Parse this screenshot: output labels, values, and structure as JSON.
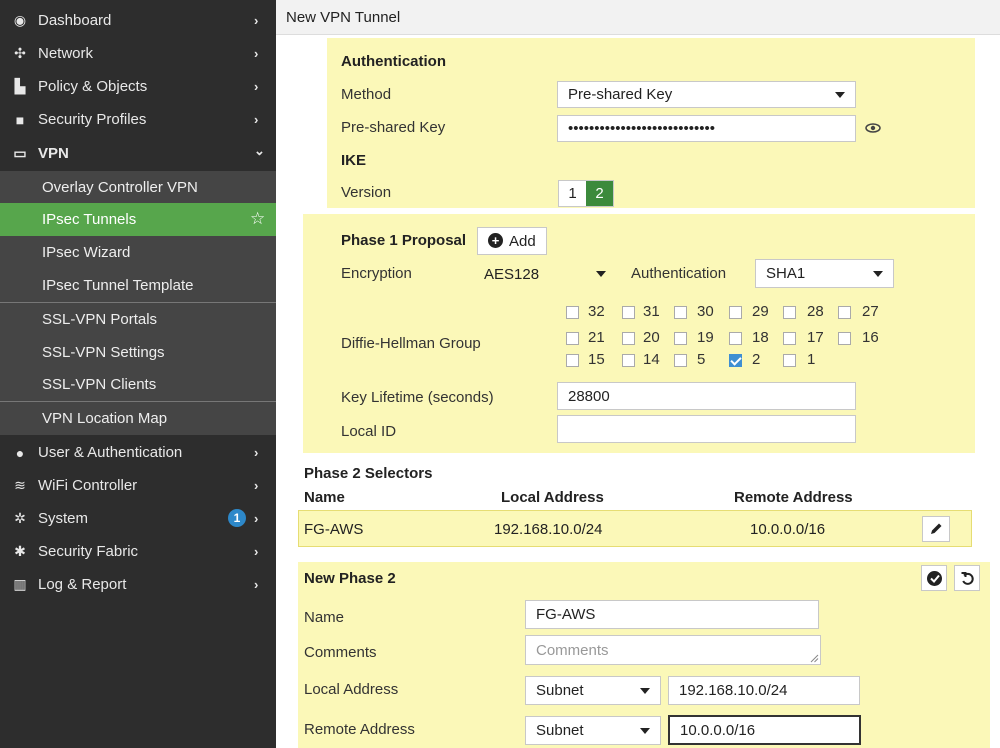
{
  "sidebar": {
    "items": [
      {
        "label": "Dashboard",
        "icon": "dashboard-icon",
        "glyph": "◉",
        "chev": "›"
      },
      {
        "label": "Network",
        "icon": "network-icon",
        "glyph": "✣",
        "chev": "›"
      },
      {
        "label": "Policy & Objects",
        "icon": "policy-icon",
        "glyph": "▙",
        "chev": "›"
      },
      {
        "label": "Security Profiles",
        "icon": "lock-icon",
        "glyph": "■",
        "chev": "›"
      },
      {
        "label": "VPN",
        "icon": "laptop-icon",
        "glyph": "▭",
        "chev": "⌄"
      }
    ],
    "vpn_sub": [
      {
        "label": "Overlay Controller VPN"
      },
      {
        "label": "IPsec Tunnels",
        "active": true
      },
      {
        "label": "IPsec Wizard"
      },
      {
        "label": "IPsec Tunnel Template"
      },
      {
        "label": "SSL-VPN Portals"
      },
      {
        "label": "SSL-VPN Settings"
      },
      {
        "label": "SSL-VPN Clients"
      },
      {
        "label": "VPN Location Map"
      }
    ],
    "star_glyph": "☆",
    "items2": [
      {
        "label": "User & Authentication",
        "icon": "user-icon",
        "glyph": "●",
        "chev": "›"
      },
      {
        "label": "WiFi Controller",
        "icon": "wifi-icon",
        "glyph": "≋",
        "chev": "›"
      },
      {
        "label": "System",
        "icon": "gear-icon",
        "glyph": "✲",
        "chev": "›",
        "badge": "1"
      },
      {
        "label": "Security Fabric",
        "icon": "fabric-icon",
        "glyph": "✱",
        "chev": "›"
      },
      {
        "label": "Log & Report",
        "icon": "chart-icon",
        "glyph": "▥",
        "chev": "›"
      }
    ]
  },
  "topbar": {
    "title": "New VPN Tunnel"
  },
  "auth": {
    "header": "Authentication",
    "method_label": "Method",
    "method_value": "Pre-shared Key",
    "psk_label": "Pre-shared Key",
    "psk_value": "••••••••••••••••••••••••••••",
    "ike_header": "IKE",
    "version_label": "Version",
    "version_opts": [
      "1",
      "2"
    ],
    "version_selected": "2"
  },
  "phase1": {
    "header": "Phase 1 Proposal",
    "add_label": "Add",
    "encryption_label": "Encryption",
    "encryption_value": "AES128",
    "authentication_label": "Authentication",
    "authentication_value": "SHA1",
    "dh_label": "Diffie-Hellman Group",
    "dh_rows": [
      [
        "32",
        "31",
        "30",
        "29",
        "28",
        "27"
      ],
      [
        "21",
        "20",
        "19",
        "18",
        "17",
        "16"
      ],
      [
        "15",
        "14",
        "5",
        "2",
        "1"
      ]
    ],
    "dh_checked": [
      "2"
    ],
    "lifetime_label": "Key Lifetime (seconds)",
    "lifetime_value": "28800",
    "localid_label": "Local ID",
    "localid_value": ""
  },
  "phase2": {
    "header": "Phase 2 Selectors",
    "columns": [
      "Name",
      "Local Address",
      "Remote Address"
    ],
    "rows": [
      {
        "name": "FG-AWS",
        "local": "192.168.10.0/24",
        "remote": "10.0.0.0/16"
      }
    ]
  },
  "newphase2": {
    "header": "New Phase 2",
    "name_label": "Name",
    "name_value": "FG-AWS",
    "comments_label": "Comments",
    "comments_placeholder": "Comments",
    "local_label": "Local Address",
    "local_type": "Subnet",
    "local_value": "192.168.10.0/24",
    "remote_label": "Remote Address",
    "remote_type": "Subnet",
    "remote_value": "10.0.0.0/16"
  },
  "colors": {
    "accent": "#57a64c",
    "panel": "#fbf8b8",
    "sidebar": "#2d2d2d",
    "checkbox": "#3f8fd2"
  }
}
